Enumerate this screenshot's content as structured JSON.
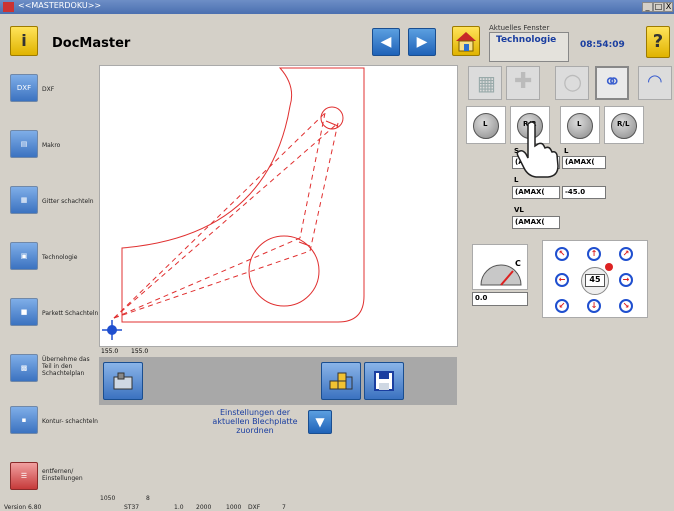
{
  "window": {
    "title": "<<MASTERDOKU>>",
    "min": "_",
    "max": "□",
    "close": "X"
  },
  "toolbar": {
    "info_icon": "info-icon",
    "app_title": "DocMaster",
    "back_icon": "arrow-left-icon",
    "forward_icon": "arrow-right-icon",
    "home_icon": "home-icon",
    "aktuelles_label": "Aktuelles Fenster",
    "aktuelles_value": "Technologie",
    "clock": "08:54:09",
    "help_label": "?"
  },
  "sidebar": {
    "items": [
      {
        "label": "DXF",
        "icon": "dxf-icon",
        "icon_text": "DXF"
      },
      {
        "label": "Makro",
        "icon": "macro-icon",
        "icon_text": ""
      },
      {
        "label": "Gitter schachteln",
        "icon": "grid-nest-icon",
        "icon_text": ""
      },
      {
        "label": "Technologie",
        "icon": "technology-icon",
        "icon_text": ""
      },
      {
        "label": "Parkett Schachteln",
        "icon": "parquet-nest-icon",
        "icon_text": ""
      },
      {
        "label": "Übernehme das Teil in den Schachtelplan",
        "icon": "transfer-part-icon",
        "icon_text": ""
      },
      {
        "label": "Kontur- schachteln",
        "icon": "contour-nest-icon",
        "icon_text": ""
      },
      {
        "label": "entfernen/ Einstellungen",
        "icon": "remove-settings-icon",
        "icon_text": ""
      }
    ]
  },
  "canvas": {
    "coord_x": "155.0",
    "coord_y": "155.0"
  },
  "bottom": {
    "einst_text": "Einstellungen der aktuellen Blechplatte zuordnen"
  },
  "right": {
    "circle_tools": [
      "L",
      "R/R",
      "L",
      "R/L"
    ],
    "table": {
      "row1_label_a": "S",
      "row1_label_b": "L",
      "row1_val_a": "(AMAX(",
      "row1_val_b": "(AMAX(",
      "row2_label_a": "L",
      "row2_val_a": "(AMAX(",
      "row2_val_b": "-45.0",
      "row3_label_a": "VL",
      "row3_val_a": "(AMAX("
    },
    "c_label": "C",
    "c_value": "0.0",
    "angle_value": "45"
  },
  "status": {
    "version": "Version 6.80",
    "val1": "1050",
    "val2": "8",
    "val3": "ST37",
    "val4": "1.0",
    "val5": "2000",
    "val6": "1000",
    "val7": "DXF",
    "val8": "7"
  },
  "colors": {
    "drawing": "#e03030",
    "accent_blue": "#1f62b8",
    "title_blue": "#4a6fb0"
  }
}
